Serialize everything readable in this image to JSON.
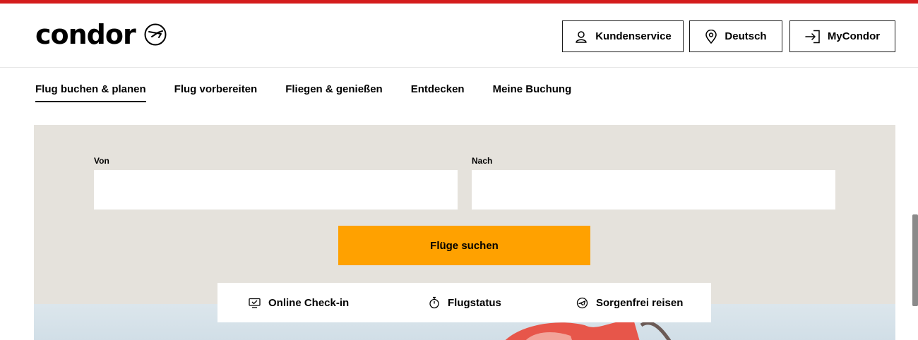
{
  "brand": {
    "name": "condor",
    "accent": "#d41c1c",
    "cta_color": "#ffa100",
    "panel_color": "#e5e2dc"
  },
  "header": {
    "buttons": [
      {
        "label": "Kundenservice",
        "icon": "person-icon"
      },
      {
        "label": "Deutsch",
        "icon": "location-pin-icon"
      },
      {
        "label": "MyCondor",
        "icon": "login-arrow-icon"
      }
    ]
  },
  "nav": {
    "items": [
      {
        "label": "Flug buchen & planen",
        "active": true
      },
      {
        "label": "Flug vorbereiten"
      },
      {
        "label": "Fliegen & genießen"
      },
      {
        "label": "Entdecken"
      },
      {
        "label": "Meine Buchung"
      }
    ]
  },
  "search": {
    "from_label": "Von",
    "from_value": "",
    "to_label": "Nach",
    "to_value": "",
    "button_label": "Flüge suchen"
  },
  "quicklinks": [
    {
      "label": "Online Check-in",
      "icon": "monitor-checkin-icon"
    },
    {
      "label": "Flugstatus",
      "icon": "stopwatch-icon"
    },
    {
      "label": "Sorgenfrei reisen",
      "icon": "shield-plane-icon"
    }
  ]
}
